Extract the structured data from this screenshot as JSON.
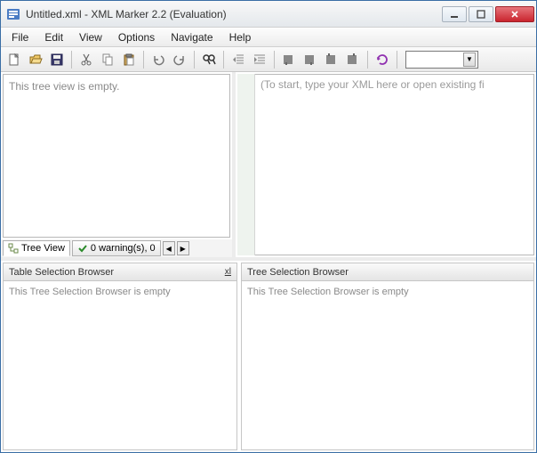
{
  "window": {
    "title": "Untitled.xml - XML Marker 2.2 (Evaluation)"
  },
  "menu": {
    "file": "File",
    "edit": "Edit",
    "view": "View",
    "options": "Options",
    "navigate": "Navigate",
    "help": "Help"
  },
  "tree": {
    "empty_text": "This tree view is empty."
  },
  "tabs": {
    "tree_view": "Tree View",
    "warnings": "0 warning(s), 0"
  },
  "editor": {
    "placeholder": "(To start, type your XML here or open existing fi"
  },
  "table_browser": {
    "title": "Table Selection Browser",
    "pin_label": "xl",
    "empty_text": "This Tree Selection Browser is empty"
  },
  "tree_browser": {
    "title": "Tree Selection Browser",
    "empty_text": "This Tree Selection Browser is empty"
  }
}
